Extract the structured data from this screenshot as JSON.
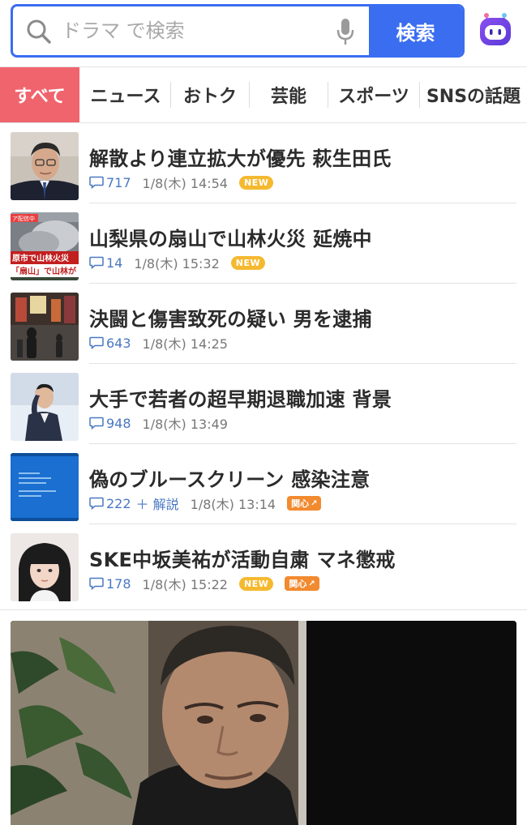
{
  "search": {
    "placeholder": "ドラマ で検索",
    "button_label": "検索"
  },
  "tabs": [
    {
      "label": "すべて",
      "active": true
    },
    {
      "label": "ニュース",
      "active": false
    },
    {
      "label": "おトク",
      "active": false
    },
    {
      "label": "芸能",
      "active": false
    },
    {
      "label": "スポーツ",
      "active": false
    },
    {
      "label": "SNSの話題",
      "active": false
    }
  ],
  "news": [
    {
      "headline": "解散より連立拡大が優先 萩生田氏",
      "comments": "717",
      "extra": "",
      "time": "1/8(木) 14:54",
      "badges": [
        "NEW"
      ]
    },
    {
      "headline": "山梨県の扇山で山林火災 延焼中",
      "comments": "14",
      "extra": "",
      "time": "1/8(木) 15:32",
      "badges": [
        "NEW"
      ],
      "thumb_caption_top": "ア配信中",
      "thumb_caption_1": "原市で山林火災",
      "thumb_caption_2": "「扇山」で山林が"
    },
    {
      "headline": "決闘と傷害致死の疑い 男を逮捕",
      "comments": "643",
      "extra": "",
      "time": "1/8(木) 14:25",
      "badges": []
    },
    {
      "headline": "大手で若者の超早期退職加速 背景",
      "comments": "948",
      "extra": "",
      "time": "1/8(木) 13:49",
      "badges": []
    },
    {
      "headline": "偽のブルースクリーン 感染注意",
      "comments": "222",
      "extra": "＋ 解説",
      "time": "1/8(木) 13:14",
      "badges": [
        "関心"
      ]
    },
    {
      "headline": "SKE中坂美祐が活動自粛 マネ懲戒",
      "comments": "178",
      "extra": "",
      "time": "1/8(木) 15:22",
      "badges": [
        "NEW",
        "関心"
      ]
    }
  ],
  "colors": {
    "accent_blue": "#3a6df0",
    "active_tab": "#f0646e",
    "new_badge": "#f5b930",
    "kanshin_badge": "#f28a2f",
    "comment_blue": "#4a78c2"
  },
  "icons": {
    "search": "search-icon",
    "mic": "mic-icon",
    "assistant": "assistant-icon",
    "comment": "comment-icon",
    "up_arrow": "arrow-icon"
  }
}
